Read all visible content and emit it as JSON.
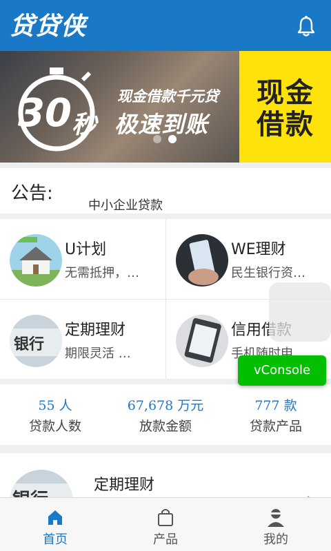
{
  "header": {
    "logo_text": "贷贷侠",
    "bell_icon": "bell-icon",
    "bg_color": "#1a79c6"
  },
  "banner": {
    "number": "30",
    "unit": "秒",
    "subtitle": "现金借款千元贷",
    "headline": "极速到账",
    "side_text": "现金借款",
    "slides_total": 2,
    "active_slide": 2
  },
  "notice": {
    "label": "公告:",
    "text": "中小企业贷款"
  },
  "products": [
    {
      "title": "U计划",
      "desc": "无需抵押，…",
      "thumb": "house-thumbnail"
    },
    {
      "title": "WE理财",
      "desc": "民生银行资…",
      "thumb": "phone-hand-thumbnail"
    },
    {
      "title": "定期理财",
      "desc": "期限灵活 …",
      "thumb": "bank-sign-thumbnail"
    },
    {
      "title": "信用借款",
      "desc": "手机随时申…",
      "thumb": "phone-app-thumbnail"
    }
  ],
  "stats": [
    {
      "value": "55 人",
      "label": "贷款人数"
    },
    {
      "value": "67,678 万元",
      "label": "放款金额"
    },
    {
      "value": "777 款",
      "label": "贷款产品"
    }
  ],
  "list": [
    {
      "title": "定期理财",
      "thumb": "bank-sign-thumbnail"
    }
  ],
  "tabs": [
    {
      "label": "首页",
      "icon": "home-icon",
      "active": true
    },
    {
      "label": "产品",
      "icon": "bag-icon",
      "active": false
    },
    {
      "label": "我的",
      "icon": "user-icon",
      "active": false
    }
  ],
  "vconsole": {
    "label": "vConsole",
    "color": "#04be02"
  }
}
